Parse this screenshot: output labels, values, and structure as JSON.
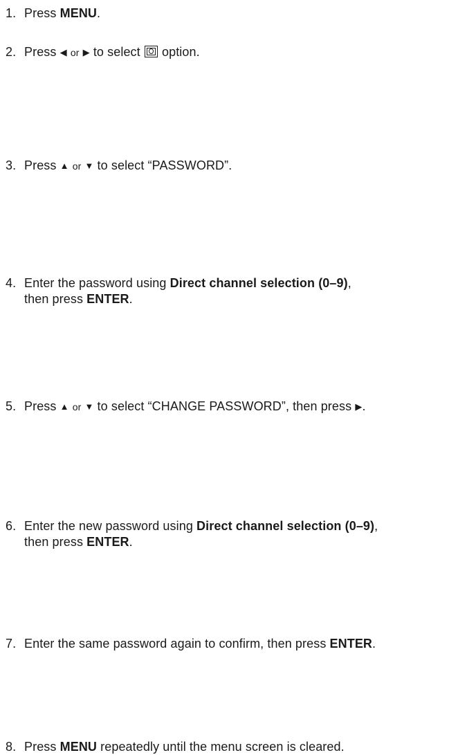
{
  "steps": [
    {
      "num": "1.",
      "pre": "Press ",
      "bold": "MENU",
      "post": "."
    },
    {
      "num": "2.",
      "pre": "Press ",
      "left_glyph": "◀",
      "or": "or",
      "right_glyph": "▶",
      "mid": "to select",
      "icon": "lock-option-icon",
      "post": "option."
    },
    {
      "num": "3.",
      "pre": "Press ",
      "up_glyph": "▲",
      "or": "or",
      "down_glyph": "▼",
      "post": "to select “PASSWORD”."
    },
    {
      "num": "4.",
      "pre": "Enter the password using ",
      "bold": "Direct channel selection (0–9)",
      "post": ",",
      "line2_pre": "then press ",
      "line2_bold": "ENTER",
      "line2_post": "."
    },
    {
      "num": "5.",
      "pre": "Press ",
      "up_glyph": "▲",
      "or": "or",
      "down_glyph": "▼",
      "mid": "to select “CHANGE PASSWORD”, then press",
      "right_glyph": "▶",
      "post": "."
    },
    {
      "num": "6.",
      "pre": "Enter the new password using ",
      "bold": "Direct channel selection (0–9)",
      "post": ",",
      "line2_pre": "then press ",
      "line2_bold": "ENTER",
      "line2_post": "."
    },
    {
      "num": "7.",
      "pre": "Enter the same password again to confirm, then press ",
      "bold": "ENTER",
      "post": "."
    },
    {
      "num": "8.",
      "pre": "Press ",
      "bold": "MENU",
      "post": " repeatedly until the menu screen is cleared."
    }
  ]
}
